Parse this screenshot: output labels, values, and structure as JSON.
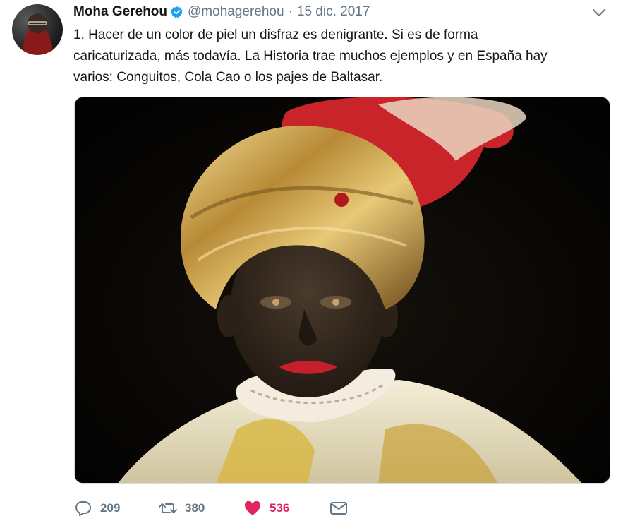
{
  "author": {
    "name": "Moha Gerehou",
    "handle": "@mohagerehou",
    "separator": "·",
    "date": "15 dic. 2017",
    "verified": true
  },
  "tweet": {
    "lines": [
      "1. Hacer de un color de piel un disfraz es denigrante. Si es de forma",
      "caricaturizada, más todavía. La Historia trae muchos ejemplos y en España hay",
      "varios: Conguitos, Cola Cao o los pajes de Baltasar."
    ]
  },
  "media": {
    "icon": "photo-image"
  },
  "actions": {
    "reply_count": "209",
    "retweet_count": "380",
    "like_count": "536"
  },
  "colors": {
    "text": "#14171a",
    "secondary": "#657786",
    "verified": "#1da1f2",
    "like": "#e0245e"
  },
  "icons": {
    "reply": "reply-icon",
    "retweet": "retweet-icon",
    "like": "heart-icon",
    "dm": "envelope-icon",
    "menu": "chevron-down-icon",
    "verified": "verified-badge-icon"
  }
}
